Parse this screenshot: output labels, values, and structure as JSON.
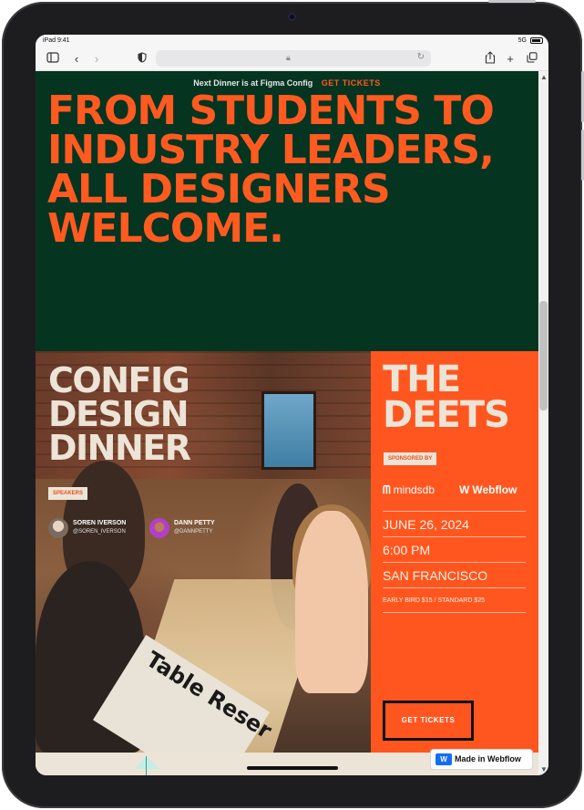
{
  "device": {
    "status_time": "iPad 9:41",
    "network": "5G"
  },
  "browser": {
    "icons": [
      "sidebar-icon",
      "back-icon",
      "forward-icon",
      "shield-icon",
      "lock-icon",
      "reload-icon",
      "share-icon",
      "new-tab-icon",
      "tabs-icon"
    ]
  },
  "banner": {
    "text": "Next Dinner is at Figma Config",
    "link": "GET TICKETS"
  },
  "hero": {
    "line1": "FROM STUDENTS TO",
    "line2": "INDUSTRY LEADERS,",
    "line3": "ALL DESIGNERS",
    "line4": "WELCOME."
  },
  "event": {
    "title_line1": "CONFIG",
    "title_line2": "DESIGN",
    "title_line3": "DINNER",
    "speakers_label": "SPEAKERS",
    "speakers": [
      {
        "name": "SOREN IVERSON",
        "handle": "@SOREN_IVERSON"
      },
      {
        "name": "DANN PETTY",
        "handle": "@DANNPETTY"
      }
    ],
    "photo_sign": "Table Reser"
  },
  "deets": {
    "title_line1": "THE",
    "title_line2": "DEETS",
    "sponsored_label": "SPONSORED BY",
    "sponsors": [
      "mindsdb",
      "Webflow"
    ],
    "date": "JUNE 26, 2024",
    "time": "6:00 PM",
    "location": "SAN FRANCISCO",
    "pricing": "EARLY BIRD $15 / STANDARD $25",
    "cta": "GET TICKETS"
  },
  "badge": {
    "label": "Made in Webflow"
  },
  "colors": {
    "hero_bg": "#053421",
    "accent": "#ff561f",
    "cream": "#ece4d6"
  }
}
